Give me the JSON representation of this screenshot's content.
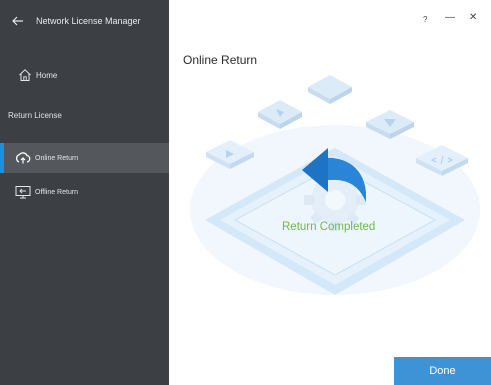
{
  "sidebar": {
    "title": "Network License Manager",
    "home_label": "Home",
    "section_label": "Return License",
    "items": [
      {
        "label": "Online Return",
        "icon": "cloud-return-icon",
        "active": true
      },
      {
        "label": "Offline Return",
        "icon": "computer-return-icon",
        "active": false
      }
    ]
  },
  "window": {
    "help": "?",
    "minimize": "—",
    "close": "✕"
  },
  "main": {
    "title": "Online Return",
    "status": "Return Completed",
    "done_label": "Done"
  },
  "colors": {
    "sidebar_bg": "#3c3f43",
    "active_item_bg": "#54585d",
    "accent_blue": "#1b8fe0",
    "success_green": "#6fb84a",
    "button_blue": "#3d93d6"
  }
}
